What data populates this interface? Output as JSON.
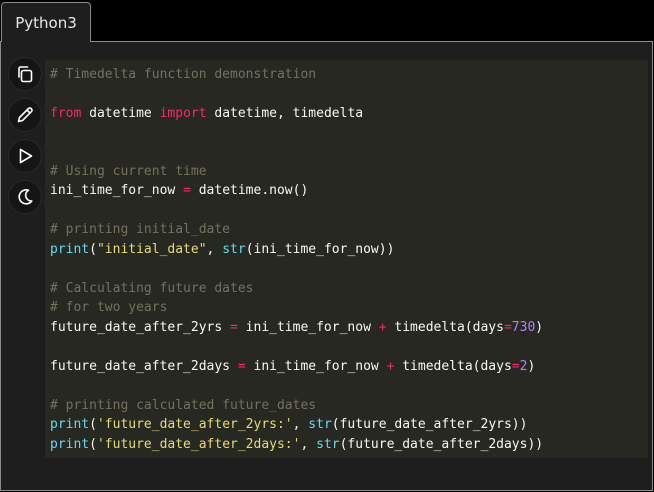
{
  "tab": {
    "label": "Python3"
  },
  "toolbar": {
    "buttons": [
      {
        "name": "copy",
        "icon": "copy-icon"
      },
      {
        "name": "edit",
        "icon": "pencil-icon"
      },
      {
        "name": "run",
        "icon": "play-icon"
      },
      {
        "name": "theme",
        "icon": "moon-icon"
      }
    ]
  },
  "code": {
    "language": "Python3",
    "lines": {
      "l1": {
        "comment": "# Timedelta function demonstration"
      },
      "l2": {
        "kw_from": "from",
        "mod": " datetime ",
        "kw_import": "import",
        "names": " datetime, timedelta"
      },
      "l3": {
        "comment": "# Using current time"
      },
      "l4": {
        "lhs": "ini_time_for_now ",
        "op": "=",
        "rhs": " datetime.now()"
      },
      "l5": {
        "comment": "# printing initial_date"
      },
      "l6": {
        "fn_print": "print",
        "p1": "(",
        "str": "\"initial_date\"",
        "p2": ", ",
        "fn_str": "str",
        "p3": "(ini_time_for_now))"
      },
      "l7": {
        "comment": "# Calculating future dates"
      },
      "l8": {
        "comment": "# for two years"
      },
      "l9": {
        "lhs": "future_date_after_2yrs ",
        "op1": "=",
        "mid": " ini_time_for_now ",
        "op2": "+",
        "call": " timedelta(days",
        "op3": "=",
        "num": "730",
        "end": ")"
      },
      "l10": {
        "lhs": "future_date_after_2days ",
        "op1": "=",
        "mid": " ini_time_for_now ",
        "op2": "+",
        "call": " timedelta(days",
        "op3": "=",
        "num": "2",
        "end": ")"
      },
      "l11": {
        "comment": "# printing calculated future_dates"
      },
      "l12": {
        "fn_print": "print",
        "p1": "(",
        "str": "'future_date_after_2yrs:'",
        "p2": ", ",
        "fn_str": "str",
        "p3": "(future_date_after_2yrs))"
      },
      "l13": {
        "fn_print": "print",
        "p1": "(",
        "str": "'future_date_after_2days:'",
        "p2": ", ",
        "fn_str": "str",
        "p3": "(future_date_after_2days))"
      }
    }
  },
  "colors": {
    "background": "#1e1e1e",
    "code_background": "#272822",
    "comment": "#75715e",
    "keyword": "#f92672",
    "builtin": "#66d9ef",
    "string": "#e6db74",
    "number": "#ae81ff",
    "text": "#f8f8f2"
  }
}
